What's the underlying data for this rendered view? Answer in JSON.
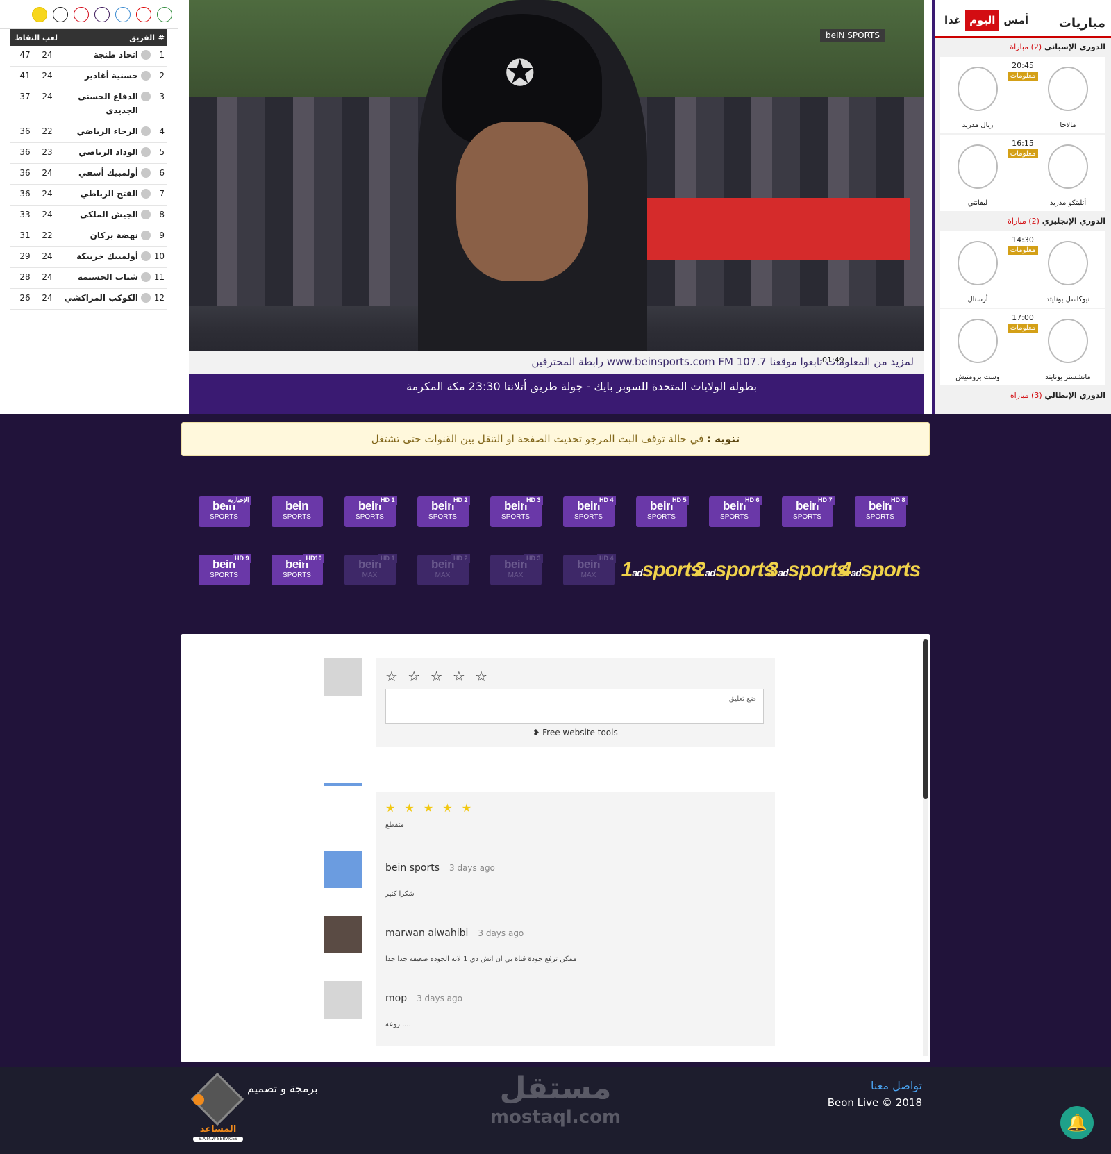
{
  "standings": {
    "league_logos": [
      "botola-logo",
      "ligue1-logo",
      "bundesliga-logo",
      "premier-league-logo",
      "serie-a-logo",
      "laliga-logo",
      "league-cup-logo"
    ],
    "header": {
      "rank": "#",
      "team": "الفريق",
      "played": "لعب",
      "points": "النقاط"
    },
    "rows": [
      {
        "rank": "1",
        "team": "اتحاد طنجة",
        "played": "24",
        "points": "47"
      },
      {
        "rank": "2",
        "team": "حسنية أغادير",
        "played": "24",
        "points": "41"
      },
      {
        "rank": "3",
        "team": "الدفاع الحسني الجديدي",
        "played": "24",
        "points": "37"
      },
      {
        "rank": "4",
        "team": "الرجاء الرياضي",
        "played": "22",
        "points": "36"
      },
      {
        "rank": "5",
        "team": "الوداد الرياضي",
        "played": "23",
        "points": "36"
      },
      {
        "rank": "6",
        "team": "أولمبيك أسفي",
        "played": "24",
        "points": "36"
      },
      {
        "rank": "7",
        "team": "الفتح الرباطي",
        "played": "24",
        "points": "36"
      },
      {
        "rank": "8",
        "team": "الجيش الملكي",
        "played": "24",
        "points": "33"
      },
      {
        "rank": "9",
        "team": "نهضة بركان",
        "played": "22",
        "points": "31"
      },
      {
        "rank": "10",
        "team": "أولمبيك خريبكة",
        "played": "24",
        "points": "29"
      },
      {
        "rank": "11",
        "team": "شباب الحسيمة",
        "played": "24",
        "points": "28"
      },
      {
        "rank": "12",
        "team": "الكوكب المراكشي",
        "played": "24",
        "points": "26"
      }
    ]
  },
  "video": {
    "channel_bug": "beIN SPORTS",
    "ticker_line": "لمزيد من المعلومات تابعوا موقعنا www.beinsports.com  FM 107.7  رابطة المحترفين",
    "ticker_bottom": "بطولة الولايات المتحدة للسوبر بايك - جولة طريق أتلانتا 23:30 مكة المكرمة",
    "clock": "01:49"
  },
  "matches": {
    "title": "مباريات",
    "tabs": [
      {
        "label": "أمس",
        "active": false
      },
      {
        "label": "اليوم",
        "active": true
      },
      {
        "label": "غدا",
        "active": false
      }
    ],
    "leagues": [
      {
        "name": "الدوري الإسباني",
        "count": "(2) مباراة",
        "games": [
          {
            "home": "مالاجا",
            "away": "ريال مدريد",
            "time": "20:45",
            "badge": "معلومات"
          },
          {
            "home": "أتليتكو مدريد",
            "away": "ليفانتي",
            "time": "16:15",
            "badge": "معلومات"
          }
        ]
      },
      {
        "name": "الدوري الإنجليزي",
        "count": "(2) مباراة",
        "games": [
          {
            "home": "نيوكاسل يونايتد",
            "away": "أرسنال",
            "time": "14:30",
            "badge": "معلومات"
          },
          {
            "home": "مانشستر يونايتد",
            "away": "وست برومتيش",
            "time": "17:00",
            "badge": "معلومات"
          }
        ]
      },
      {
        "name": "الدوري الإيطالي",
        "count": "(3) مباراة",
        "games": []
      }
    ]
  },
  "alert": {
    "label": "تنويه :",
    "text": " في حالة توقف البث المرجو تحديث الصفحة او التنقل بين القنوات حتى تشتغل"
  },
  "channels": [
    {
      "top": "bein",
      "bottom": "SPORTS",
      "hd": "الإخبارية",
      "dim": false
    },
    {
      "top": "bein",
      "bottom": "SPORTS",
      "hd": "",
      "dim": false
    },
    {
      "top": "bein",
      "bottom": "SPORTS",
      "hd": "HD 1",
      "dim": false
    },
    {
      "top": "bein",
      "bottom": "SPORTS",
      "hd": "HD 2",
      "dim": false
    },
    {
      "top": "bein",
      "bottom": "SPORTS",
      "hd": "HD 3",
      "dim": false
    },
    {
      "top": "bein",
      "bottom": "SPORTS",
      "hd": "HD 4",
      "dim": false
    },
    {
      "top": "bein",
      "bottom": "SPORTS",
      "hd": "HD 5",
      "dim": false
    },
    {
      "top": "bein",
      "bottom": "SPORTS",
      "hd": "HD 6",
      "dim": false
    },
    {
      "top": "bein",
      "bottom": "SPORTS",
      "hd": "HD 7",
      "dim": false
    },
    {
      "top": "bein",
      "bottom": "SPORTS",
      "hd": "HD 8",
      "dim": false
    },
    {
      "top": "bein",
      "bottom": "SPORTS",
      "hd": "HD 9",
      "dim": false
    },
    {
      "top": "bein",
      "bottom": "SPORTS",
      "hd": "HD10",
      "dim": false
    },
    {
      "top": "bein",
      "bottom": "MAX",
      "hd": "HD 1",
      "dim": true
    },
    {
      "top": "bein",
      "bottom": "MAX",
      "hd": "HD 2",
      "dim": true
    },
    {
      "top": "bein",
      "bottom": "MAX",
      "hd": "HD 3",
      "dim": true
    },
    {
      "top": "bein",
      "bottom": "MAX",
      "hd": "HD 4",
      "dim": true
    }
  ],
  "ad_channels": [
    {
      "num": "1",
      "text": "sports",
      "sup": "ad"
    },
    {
      "num": "2",
      "text": "sports",
      "sup": "ad"
    },
    {
      "num": "3",
      "text": "sports",
      "sup": "ad"
    },
    {
      "num": "4",
      "text": "sports",
      "sup": "ad"
    }
  ],
  "comments": {
    "compose": {
      "stars": "☆ ☆ ☆ ☆ ☆",
      "placeholder": "ضع تعليق",
      "tools": "Free website tools"
    },
    "items": [
      {
        "user": "",
        "ago": "",
        "text": "متقطع",
        "stars": "★ ★ ★ ★ ★",
        "avatar": "blue"
      },
      {
        "user": "bein sports",
        "ago": "3 days ago",
        "text": "شكرا كثير",
        "stars": "",
        "avatar": "blue"
      },
      {
        "user": "marwan alwahibi",
        "ago": "3 days ago",
        "text": "ممكن ترفع جودة قناة بي ان  اتش دي 1 لانه الجوده ضعيفه جدا جدا",
        "stars": "",
        "avatar": "photo"
      },
      {
        "user": "mop",
        "ago": "3 days ago",
        "text": "روعة ....",
        "stars": "",
        "avatar": "gray"
      }
    ]
  },
  "footer": {
    "contact_label": "تواصل معنا",
    "copyright": "Beon Live © 2018",
    "brand_ar": "مستقل",
    "brand_en": "mostaql.com",
    "credit": "برمجة و تصميم",
    "logo_name": "المساعد",
    "logo_sub": "S.A.M.W SERVICES"
  },
  "colors": {
    "accent": "#d30d12",
    "bein_purple": "#6a38a8",
    "page_bg": "#21133a",
    "alert_bg": "#fff8dc",
    "bell": "#1fa18a"
  }
}
